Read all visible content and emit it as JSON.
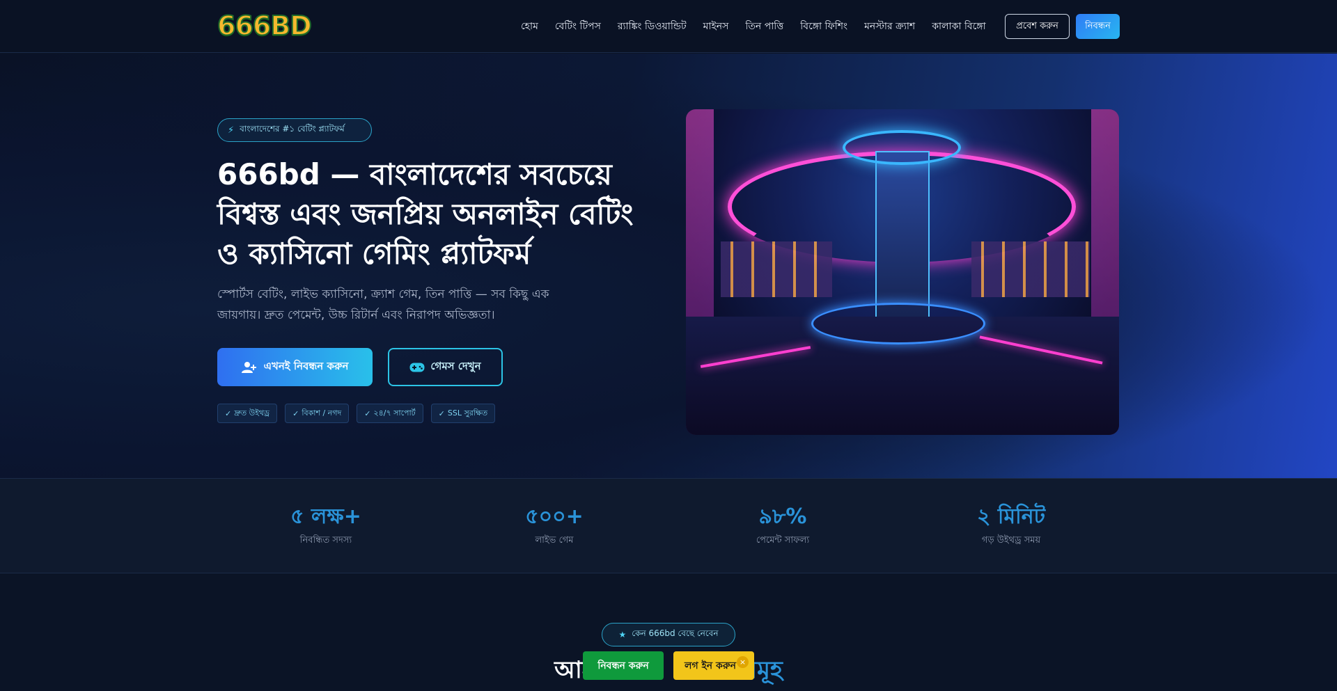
{
  "header": {
    "logo": "666BD",
    "nav": [
      "হোম",
      "বেটিং টিপস",
      "র‍্যাঙ্কিং ডিওয়ান্ডিট",
      "মাইনস",
      "তিন পাত্তি",
      "বিঙ্গো ফিশিং",
      "মনস্টার ক্র্যাশ",
      "কালাকা বিঙ্গো"
    ],
    "login_label": "প্রবেশ করুন",
    "register_label": "নিবন্ধন"
  },
  "hero": {
    "badge": "বাংলাদেশের #১ বেটিং প্ল্যাটফর্ম",
    "title": "666bd — বাংলাদেশের সবচেয়ে বিশ্বস্ত এবং জনপ্রিয় অনলাইন বেটিং ও ক্যাসিনো গেমিং প্ল্যাটফর্ম",
    "subtitle": "স্পোর্টস বেটিং, লাইভ ক্যাসিনো, ক্র্যাশ গেম, তিন পাত্তি — সব কিছু এক জায়গায়। দ্রুত পেমেন্ট, উচ্চ রিটার্ন এবং নিরাপদ অভিজ্ঞতা।",
    "cta_primary": "এখনই নিবন্ধন করুন",
    "cta_secondary": "গেমস দেখুন",
    "features": [
      "দ্রুত উইথড্র",
      "বিকাশ / নগদ",
      "২৪/৭ সাপোর্ট",
      "SSL সুরক্ষিত"
    ]
  },
  "stats": [
    {
      "value": "৫ লক্ষ+",
      "label": "নিবন্ধিত সদস্য"
    },
    {
      "value": "৫০০+",
      "label": "লাইভ গেম"
    },
    {
      "value": "৯৮%",
      "label": "পেমেন্ট সাফল্য"
    },
    {
      "value": "২ মিনিট",
      "label": "গড় উইথড্র সময়"
    }
  ],
  "why": {
    "badge": "কেন 666bd বেছে নেবেন",
    "title_start": "আম",
    "title_end": "সমূহ"
  },
  "floating": {
    "register": "নিবন্ধন করুন",
    "login": "লগ ইন করুন",
    "close": "×"
  },
  "colors": {
    "accent": "#2a93d9",
    "primary_gradient_start": "#2f6ff0",
    "primary_gradient_end": "#29c0ea",
    "register_green": "#0f9a3c",
    "login_yellow": "#f2c51a"
  },
  "icons": {
    "badge": "bolt-icon",
    "cta_primary": "user-plus-icon",
    "cta_secondary": "gamepad-icon",
    "feature": "check-icon",
    "why_badge": "star-icon"
  }
}
